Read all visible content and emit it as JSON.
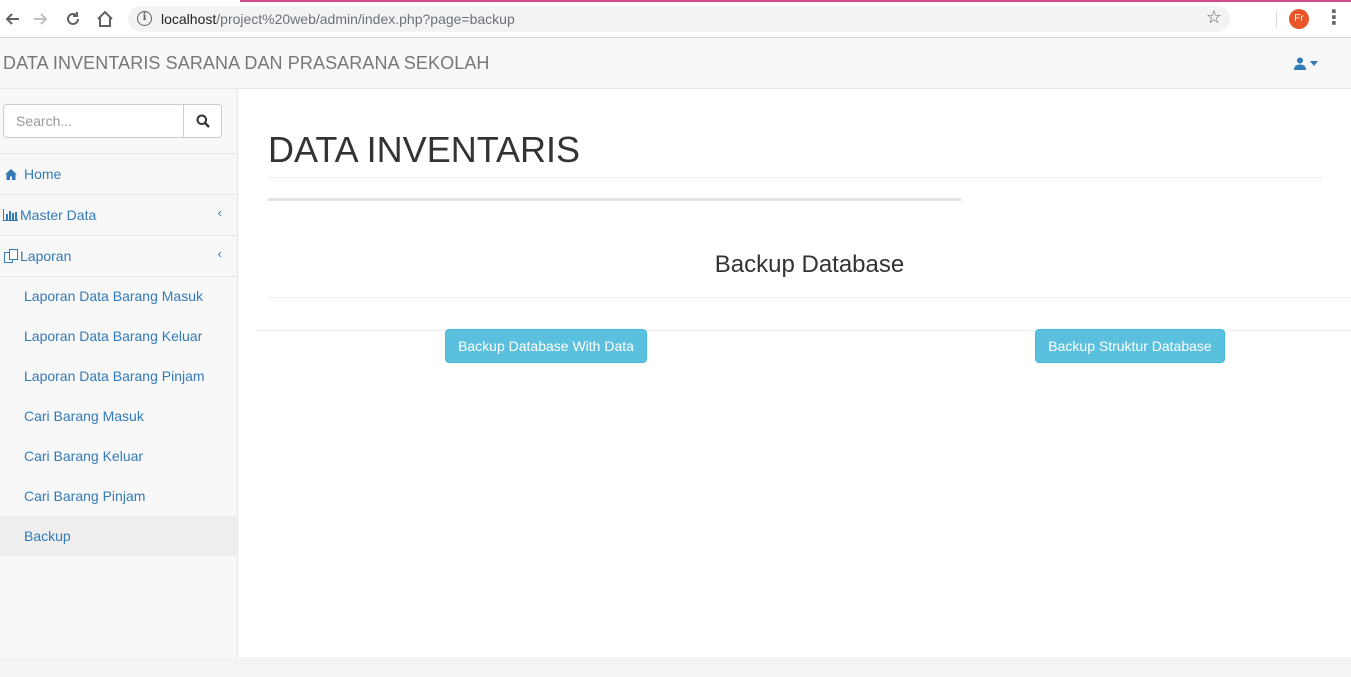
{
  "browser": {
    "url_host": "localhost",
    "url_path": "/project%20web/admin/index.php?page=backup",
    "profile_initials": "Fr"
  },
  "navbar": {
    "brand": "DATA INVENTARIS SARANA DAN PRASARANA SEKOLAH"
  },
  "sidebar": {
    "search_placeholder": "Search...",
    "items": [
      {
        "label": "Home",
        "icon": "home-icon"
      },
      {
        "label": "Master Data",
        "icon": "bar-chart-icon"
      },
      {
        "label": "Laporan",
        "icon": "files-icon"
      }
    ],
    "sub_items": [
      {
        "label": "Laporan Data Barang Masuk"
      },
      {
        "label": "Laporan Data Barang Keluar"
      },
      {
        "label": "Laporan Data Barang Pinjam"
      },
      {
        "label": "Cari Barang Masuk"
      },
      {
        "label": "Cari Barang Keluar"
      },
      {
        "label": "Cari Barang Pinjam"
      },
      {
        "label": "Backup"
      }
    ],
    "active_item": "Backup"
  },
  "main": {
    "title": "DATA INVENTARIS",
    "panel_heading": "Backup Database",
    "buttons": {
      "backup_with_data": "Backup Database With Data",
      "backup_structure": "Backup Struktur Database"
    }
  },
  "colors": {
    "link": "#337ab7",
    "button_info": "#5bc0de",
    "chrome_accent": "#d04a8e",
    "profile": "#e8562a"
  }
}
